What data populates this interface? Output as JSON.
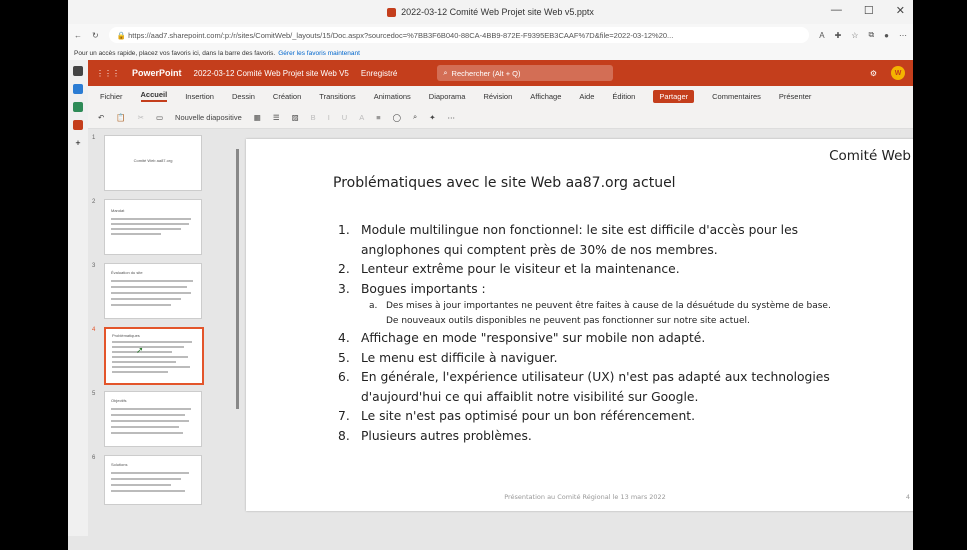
{
  "browser": {
    "tab_title": "2022-03-12 Comité Web Projet site Web v5.pptx",
    "url": "https://aad7.sharepoint.com/:p:/r/sites/ComitWeb/_layouts/15/Doc.aspx?sourcedoc=%7BB3F6B040-88CA-4BB9-872E-F9395EB3CAAF%7D&file=2022-03-12%20...",
    "favorites_text": "Pour un accès rapide, placez vos favoris ici, dans la barre des favoris.",
    "favorites_link": "Gérer les favoris maintenant"
  },
  "ppt": {
    "app_name": "PowerPoint",
    "doc_title": "2022-03-12 Comité Web Projet site Web V5",
    "save_status": "Enregistré",
    "search_placeholder": "Rechercher (Alt + Q)",
    "avatar_initial": "W"
  },
  "tabs": [
    {
      "label": "Fichier"
    },
    {
      "label": "Accueil"
    },
    {
      "label": "Insertion"
    },
    {
      "label": "Dessin"
    },
    {
      "label": "Création"
    },
    {
      "label": "Transitions"
    },
    {
      "label": "Animations"
    },
    {
      "label": "Diaporama"
    },
    {
      "label": "Révision"
    },
    {
      "label": "Affichage"
    },
    {
      "label": "Aide"
    }
  ],
  "tab_actions": {
    "edit": "Édition",
    "share": "Partager",
    "comments": "Commentaires",
    "present": "Présenter"
  },
  "toolbar": {
    "new_slide": "Nouvelle diapositive"
  },
  "thumbnails": [
    {
      "num": "1",
      "text": "Comité Web aa87.org"
    },
    {
      "num": "2",
      "text": "Mandat"
    },
    {
      "num": "3",
      "text": "Évaluation du site"
    },
    {
      "num": "4",
      "text": "Problématiques"
    },
    {
      "num": "5",
      "text": "Objectifs"
    },
    {
      "num": "6",
      "text": "Solutions"
    }
  ],
  "slide": {
    "corner": "Comité Web",
    "title": "Problématiques avec le site Web aa87.org actuel",
    "items": [
      {
        "num": "1.",
        "text": "Module multilingue non fonctionnel: le site est difficile d'accès pour les anglophones qui comptent près de 30% de nos membres."
      },
      {
        "num": "2.",
        "text": "Lenteur extrême pour le visiteur et la maintenance."
      },
      {
        "num": "3.",
        "text": "Bogues importants :"
      },
      {
        "num": "4.",
        "text": "Affichage en mode \"responsive\" sur mobile non adapté."
      },
      {
        "num": "5.",
        "text": "Le menu est difficile à naviguer."
      },
      {
        "num": "6.",
        "text": "En générale, l'expérience utilisateur (UX) n'est pas adapté aux technologies d'aujourd'hui ce qui affaiblit notre visibilité sur Google."
      },
      {
        "num": "7.",
        "text": "Le site n'est pas optimisé pour un bon référencement."
      },
      {
        "num": "8.",
        "text": "Plusieurs autres problèmes."
      }
    ],
    "subitem": {
      "num": "a.",
      "text": "Des mises à jour importantes ne peuvent être faites à cause de la désuétude du système de base. De nouveaux outils disponibles ne peuvent pas fonctionner sur notre site actuel."
    },
    "footer": "Présentation au Comité Régional le 13 mars 2022",
    "page_number": "4"
  },
  "colors": {
    "accent": "#c43e1c",
    "selection": "#e3552b"
  }
}
